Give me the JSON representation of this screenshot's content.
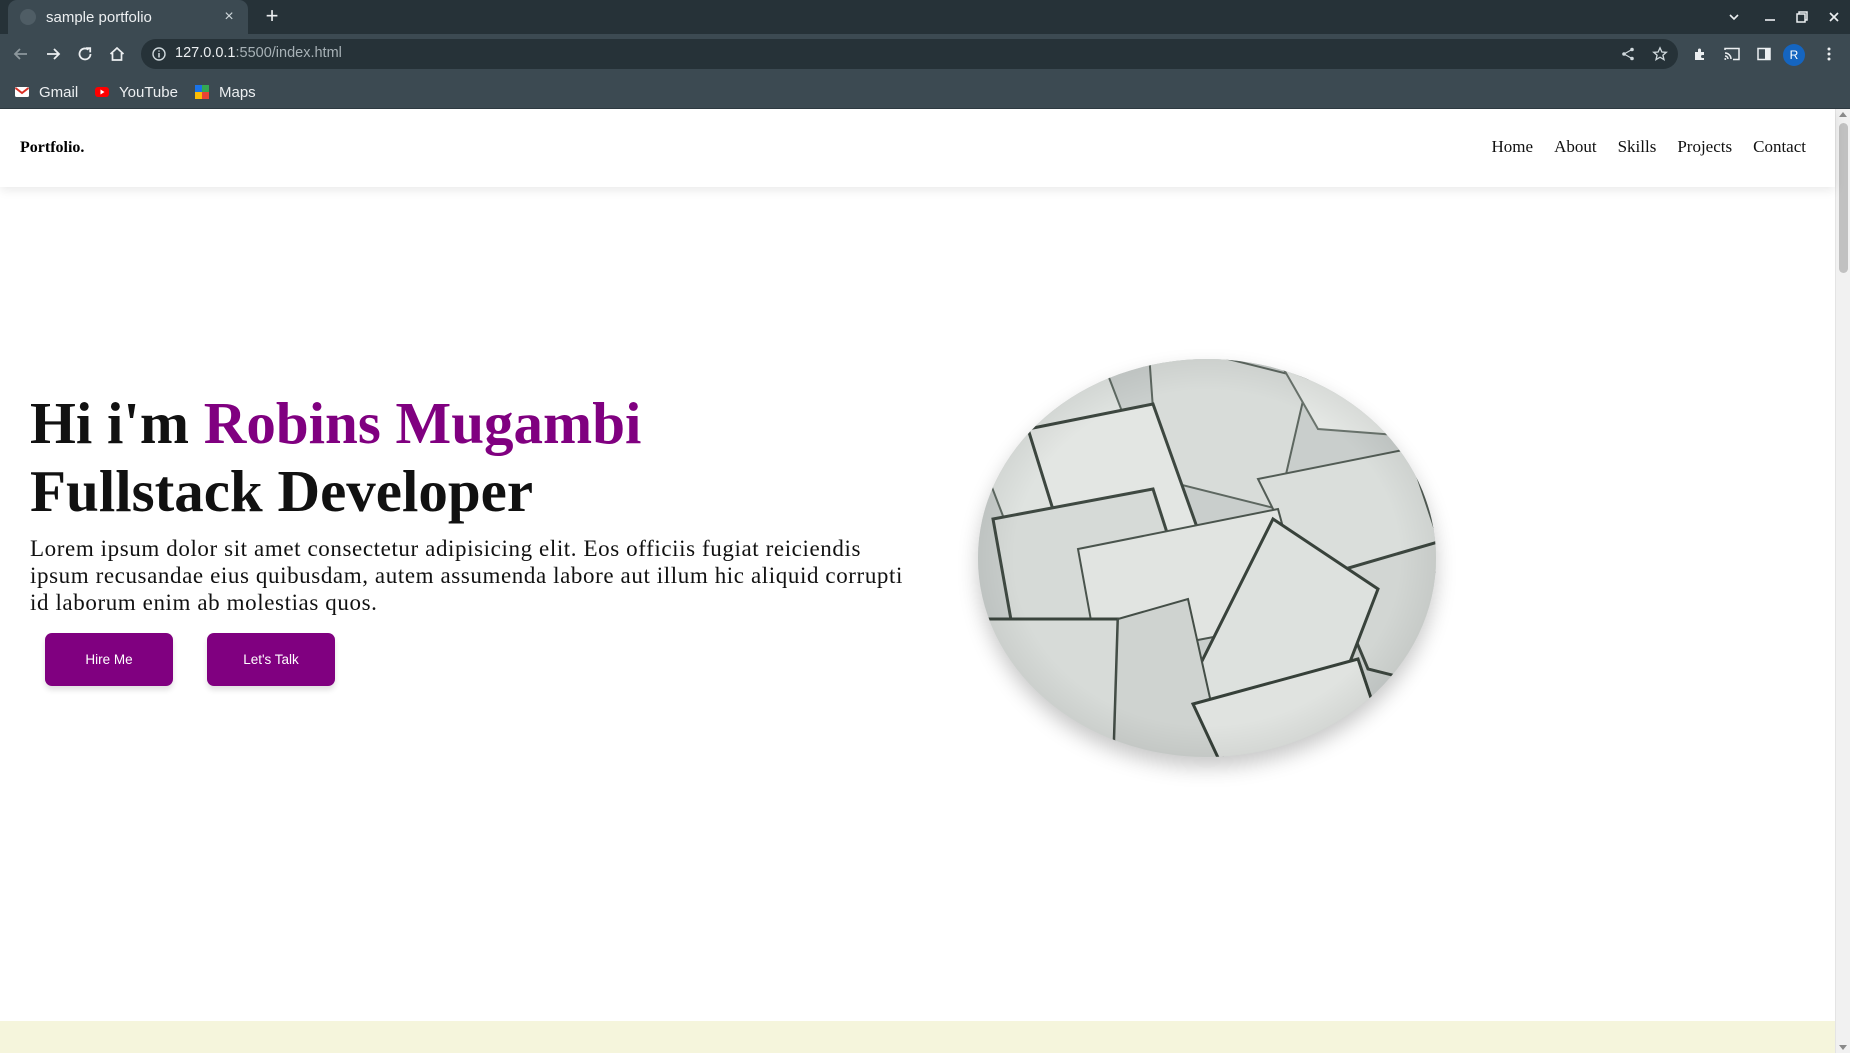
{
  "browser": {
    "tab": {
      "title": "sample portfolio",
      "close_glyph": "×"
    },
    "new_tab_glyph": "+",
    "address": {
      "host": "127.0.0.1",
      "path": ":5500/index.html"
    },
    "profile_initial": "R",
    "bookmarks": [
      {
        "label": "Gmail",
        "icon": "gmail-icon"
      },
      {
        "label": "YouTube",
        "icon": "youtube-icon"
      },
      {
        "label": "Maps",
        "icon": "maps-icon"
      }
    ]
  },
  "site": {
    "logo": "Portfolio.",
    "nav": [
      "Home",
      "About",
      "Skills",
      "Projects",
      "Contact"
    ],
    "hero": {
      "greeting": "Hi i'm",
      "name": "Robins Mugambi",
      "role": "Fullstack Developer",
      "description": "Lorem ipsum dolor sit amet consectetur adipisicing elit. Eos officiis fugiat reiciendis ipsum recusandae eius quibusdam, autem assumenda labore aut illum hic aliquid corrupti id laborum enim ab molestias quos.",
      "buttons": {
        "hire": "Hire Me",
        "talk": "Let's Talk"
      }
    }
  },
  "colors": {
    "accent": "#800080",
    "chrome_dark": "#263238",
    "chrome": "#3c4a52",
    "next_section_bg": "#f5f5dc"
  }
}
